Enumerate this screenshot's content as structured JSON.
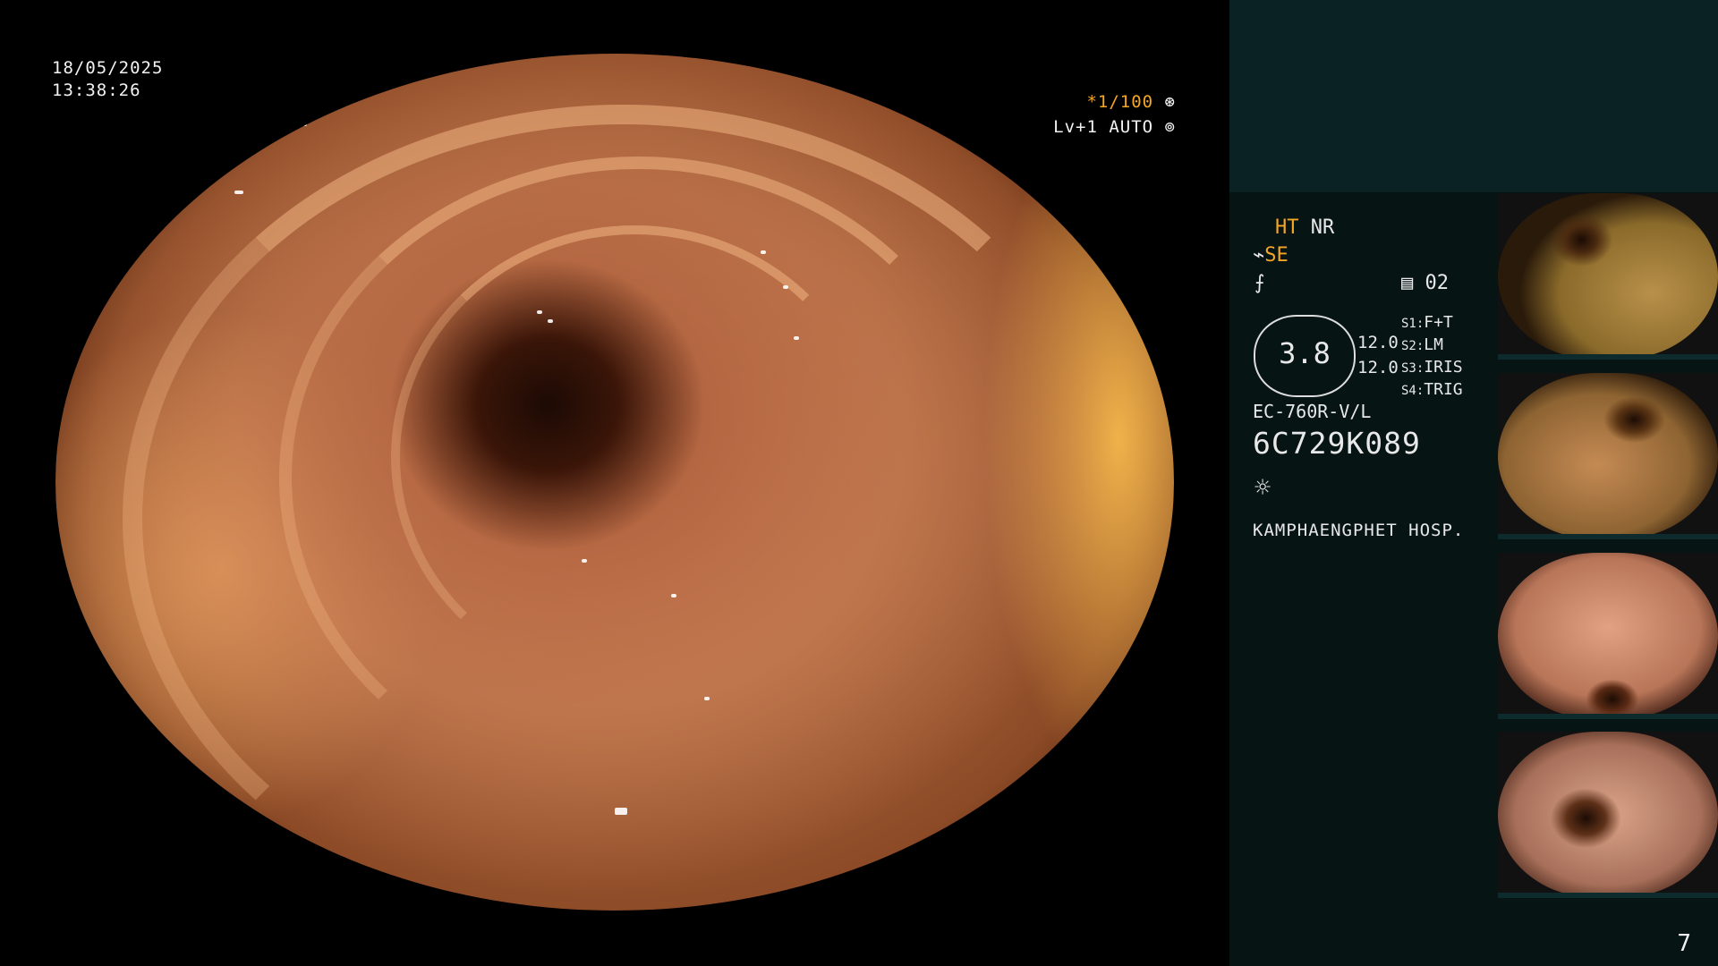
{
  "overlay": {
    "date": "18/05/2025",
    "time": "13:38:26",
    "shutter": "*1/100",
    "level": "Lv+1 AUTO"
  },
  "panel": {
    "mode_ht": "HT",
    "mode_nr": "NR",
    "mode_se": "SE",
    "memory_index": "02",
    "gauge_value": "3.8",
    "val_1": "12.0",
    "val_2": "12.0",
    "settings": [
      {
        "key": "S1:",
        "value": "F+T"
      },
      {
        "key": "S2:",
        "value": "LM"
      },
      {
        "key": "S3:",
        "value": "IRIS"
      },
      {
        "key": "S4:",
        "value": "TRIG"
      }
    ],
    "scope_model": "EC-760R-V/L",
    "scope_serial": "6C729K089",
    "hospital": "KAMPHAENGPHET HOSP."
  },
  "page_number": "7",
  "colors": {
    "accent": "#f5a623",
    "panel_bg": "#061414",
    "panel_top_bg": "#0b2224"
  },
  "icons": [
    "shutter-icon",
    "iris-icon",
    "pump-icon",
    "air-icon",
    "memory-icon",
    "light-icon"
  ]
}
